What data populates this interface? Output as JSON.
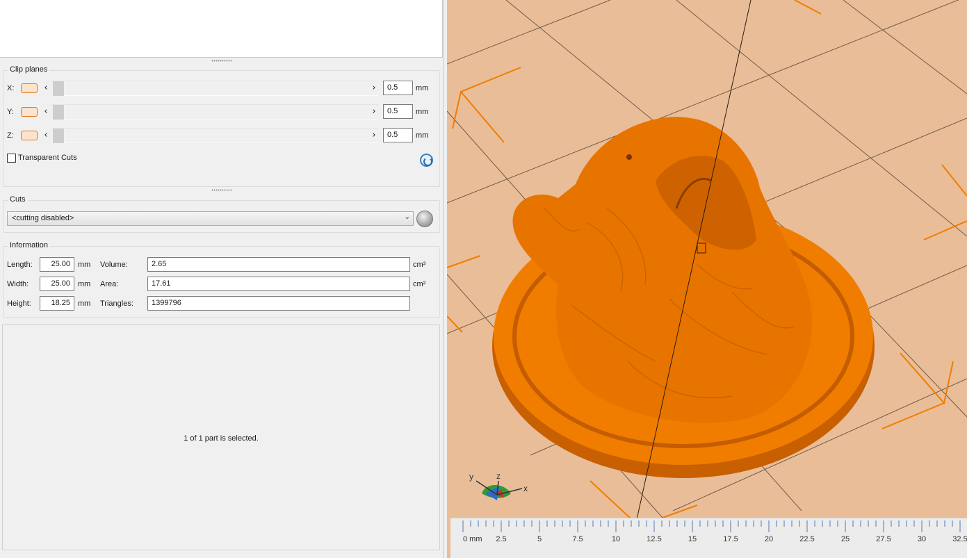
{
  "clip_planes": {
    "title": "Clip planes",
    "axes": [
      {
        "label": "X:",
        "value": "0.5",
        "unit": "mm"
      },
      {
        "label": "Y:",
        "value": "0.5",
        "unit": "mm"
      },
      {
        "label": "Z:",
        "value": "0.5",
        "unit": "mm"
      }
    ],
    "prev_glyph": "‹",
    "next_glyph": "›",
    "transparent_cuts_label": "Transparent Cuts",
    "transparent_cuts_checked": false,
    "reset_icon": "reset-icon"
  },
  "cuts": {
    "title": "Cuts",
    "selected": "<cutting disabled>",
    "sphere_icon": "sphere-icon"
  },
  "information": {
    "title": "Information",
    "length_label": "Length:",
    "length": "25.00",
    "length_unit": "mm",
    "width_label": "Width:",
    "width": "25.00",
    "width_unit": "mm",
    "height_label": "Height:",
    "height": "18.25",
    "height_unit": "mm",
    "volume_label": "Volume:",
    "volume": "2.65",
    "volume_unit": "cm³",
    "area_label": "Area:",
    "area": "17.61",
    "area_unit": "cm²",
    "triangles_label": "Triangles:",
    "triangles": "1399796"
  },
  "selection_status": "1 of 1 part is selected.",
  "viewport": {
    "axis_labels": {
      "x": "x",
      "y": "y",
      "z": "z"
    },
    "colors": {
      "bed": "#e9bd97",
      "model": "#f07d00",
      "grid_line": "#4a3a30",
      "bed_marker": "#f07d00"
    },
    "ruler": {
      "ticks": [
        "0 mm",
        "2.5",
        "5",
        "7.5",
        "10",
        "12.5",
        "15",
        "17.5",
        "20",
        "22.5",
        "25",
        "27.5",
        "30",
        "32.5"
      ]
    }
  }
}
